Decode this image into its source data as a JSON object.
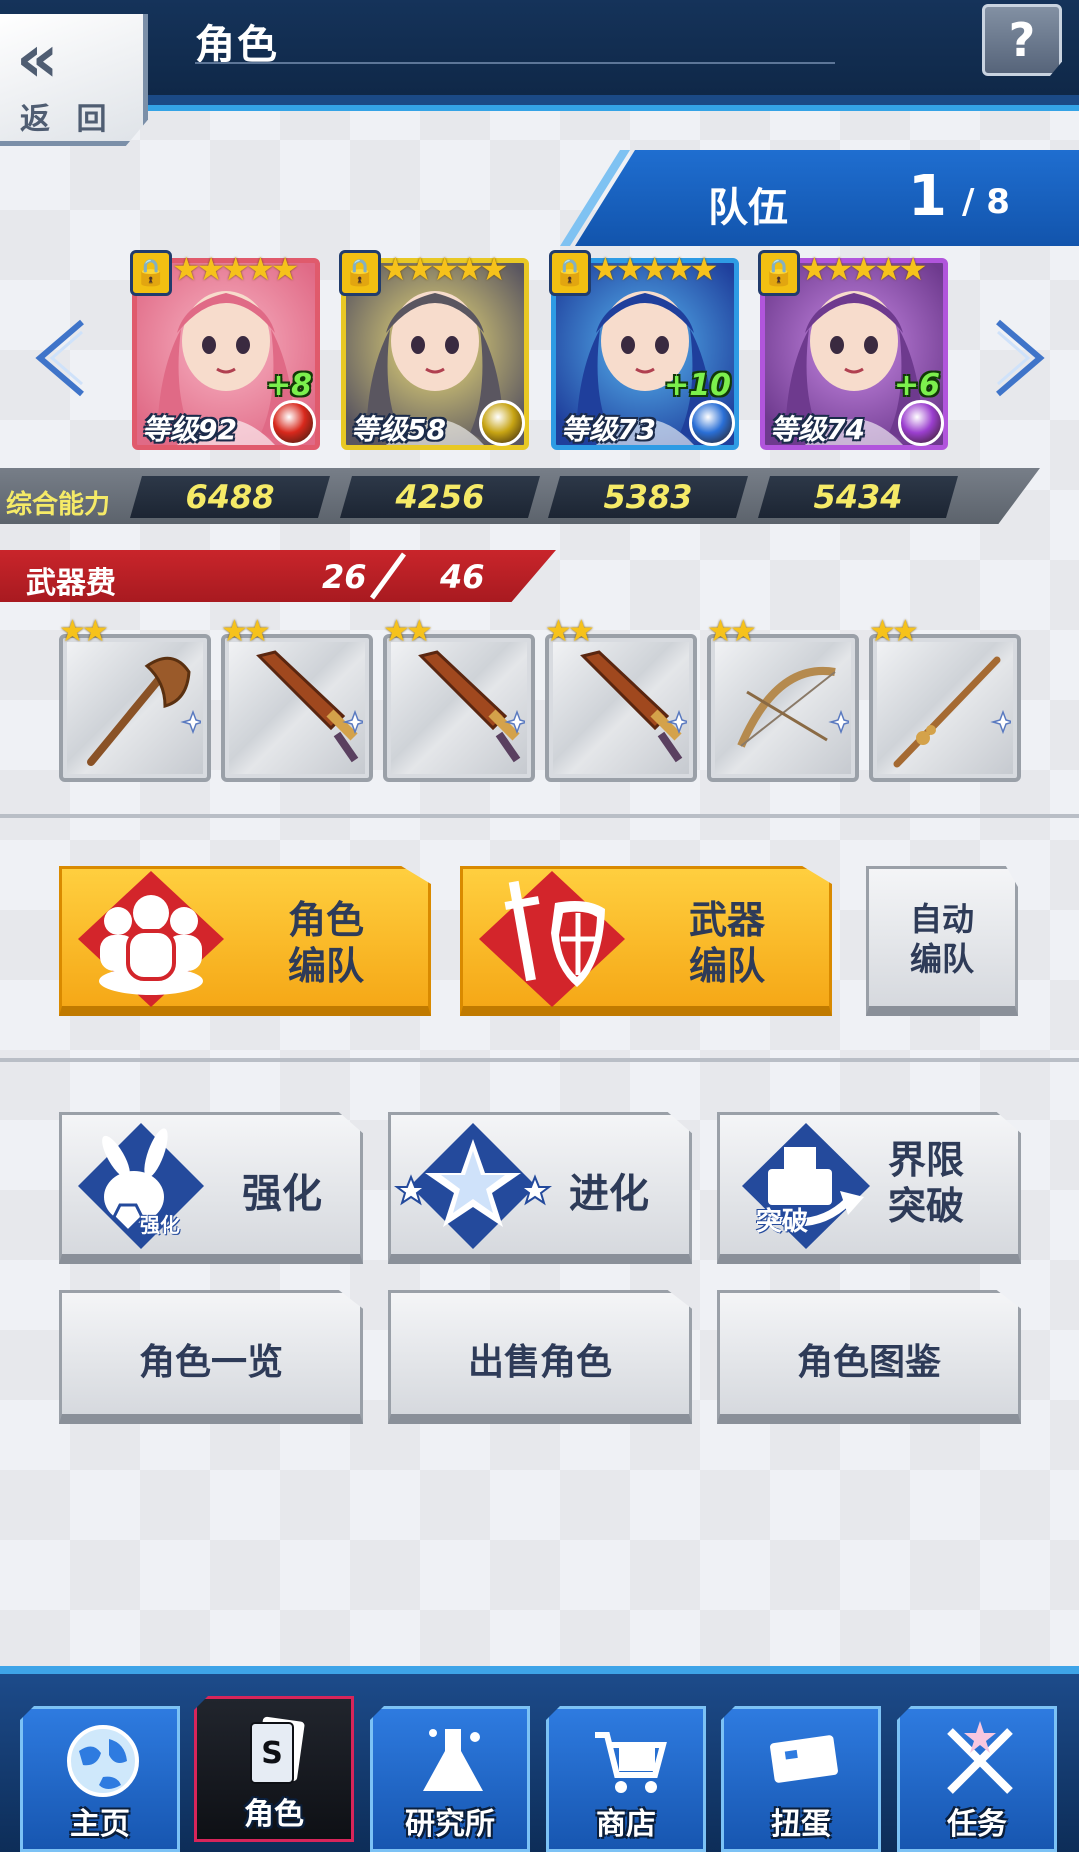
{
  "header": {
    "title": "角色",
    "back_label": "返 回",
    "back_chevrons": "«",
    "help_label": "?"
  },
  "team": {
    "label": "队伍",
    "current": "1",
    "total": "/ 8"
  },
  "characters": [
    {
      "level": "等级92",
      "plus": "+8",
      "stars": "★★★★★",
      "element": "fire",
      "power": "6488",
      "colors": [
        "#f8b4c4",
        "#e06a86"
      ],
      "elem_color": "#d8281c",
      "frame": "#e05a6c"
    },
    {
      "level": "等级58",
      "plus": "",
      "stars": "★★★★★",
      "element": "earth",
      "power": "4256",
      "colors": [
        "#f2e27a",
        "#5a5660"
      ],
      "elem_color": "#c7a413",
      "frame": "#e8c824"
    },
    {
      "level": "等级73",
      "plus": "+10",
      "stars": "★★★★★",
      "element": "water",
      "power": "5383",
      "colors": [
        "#59b8f2",
        "#1f3f9c"
      ],
      "elem_color": "#2a6fd6",
      "frame": "#2e9be4"
    },
    {
      "level": "等级74",
      "plus": "+6",
      "stars": "★★★★★",
      "element": "wind",
      "power": "5434",
      "colors": [
        "#c98ae6",
        "#6e3a8e"
      ],
      "elem_color": "#9b3fcf",
      "frame": "#b155dc"
    }
  ],
  "power": {
    "label": "综合能力"
  },
  "weapon_cost": {
    "label": "武器费",
    "used": "26",
    "max": "46"
  },
  "weapons": [
    {
      "stars": "★★",
      "type": "axe-icon"
    },
    {
      "stars": "★★",
      "type": "sword-icon"
    },
    {
      "stars": "★★",
      "type": "sword-icon"
    },
    {
      "stars": "★★",
      "type": "sword-icon"
    },
    {
      "stars": "★★",
      "type": "bow-icon"
    },
    {
      "stars": "★★",
      "type": "staff-icon"
    }
  ],
  "formation": {
    "character_btn": "角色\n编队",
    "weapon_btn": "武器\n编队",
    "auto_btn": "自动\n编队"
  },
  "actions": {
    "enhance": "强化",
    "enhance_badge": "强化",
    "evolve": "进化",
    "limit_break": "界限\n突破",
    "limit_break_badge": "突破",
    "list": "角色一览",
    "sell": "出售角色",
    "gallery": "角色图鉴"
  },
  "nav": {
    "items": [
      {
        "label": "主页",
        "icon": "globe-icon"
      },
      {
        "label": "角色",
        "icon": "card-icon"
      },
      {
        "label": "研究所",
        "icon": "flask-icon"
      },
      {
        "label": "商店",
        "icon": "cart-icon"
      },
      {
        "label": "扭蛋",
        "icon": "ticket-icon"
      },
      {
        "label": "任务",
        "icon": "swords-icon"
      }
    ]
  },
  "colors": {
    "header": "#15335a",
    "accent_blue": "#1f6ed0",
    "cost_red": "#c9252b",
    "yellow_btn": "#f5a817",
    "power_text": "#f5ea67"
  }
}
